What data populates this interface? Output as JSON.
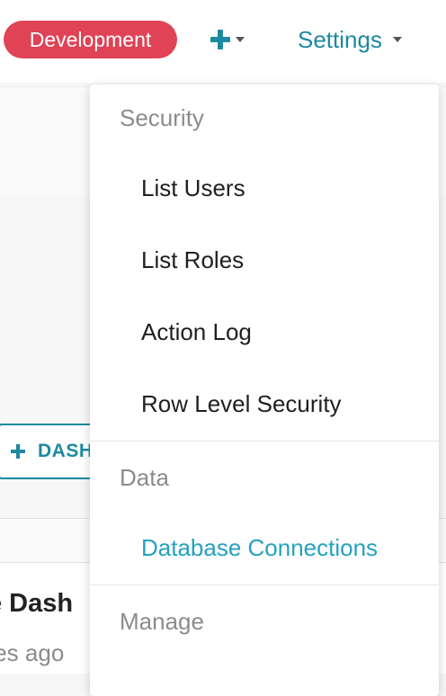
{
  "navbar": {
    "environment_badge": "Development",
    "settings_label": "Settings"
  },
  "background": {
    "add_button_label": "DASH",
    "dashboard_title": "e Dash",
    "dashboard_subtitle": "tes ago"
  },
  "dropdown": {
    "sections": [
      {
        "header": "Security",
        "items": [
          {
            "label": "List Users"
          },
          {
            "label": "List Roles"
          },
          {
            "label": "Action Log"
          },
          {
            "label": "Row Level Security"
          }
        ]
      },
      {
        "header": "Data",
        "items": [
          {
            "label": "Database Connections",
            "active": true
          }
        ]
      },
      {
        "header": "Manage",
        "items": []
      }
    ]
  },
  "colors": {
    "accent": "#1d89a0",
    "active_link": "#24a2be",
    "badge": "#e04355"
  }
}
